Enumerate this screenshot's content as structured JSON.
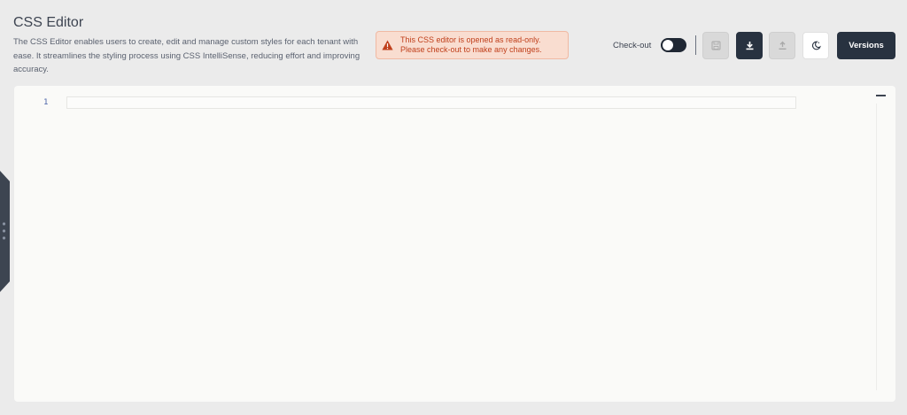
{
  "header": {
    "title": "CSS Editor",
    "description": "The CSS Editor enables users to create, edit and manage custom styles for each tenant with ease. It streamlines the styling process using CSS IntelliSense, reducing effort and improving accuracy."
  },
  "alert": {
    "icon": "warning-icon",
    "line1": "This CSS editor is opened as read-only.",
    "line2": "Please check-out to make any changes.",
    "color": "#c0401c"
  },
  "toolbar": {
    "checkout_label": "Check-out",
    "checkout_enabled": false,
    "buttons": [
      {
        "icon": "save-icon",
        "state": "disabled"
      },
      {
        "icon": "download-icon",
        "state": "enabled"
      },
      {
        "icon": "upload-icon",
        "state": "disabled"
      },
      {
        "icon": "theme-icon",
        "state": "enabled"
      }
    ],
    "versions_label": "Versions"
  },
  "editor": {
    "line_numbers": [
      "1"
    ],
    "content": ""
  },
  "colors": {
    "dark": "#283240",
    "warning": "#c0401c"
  }
}
